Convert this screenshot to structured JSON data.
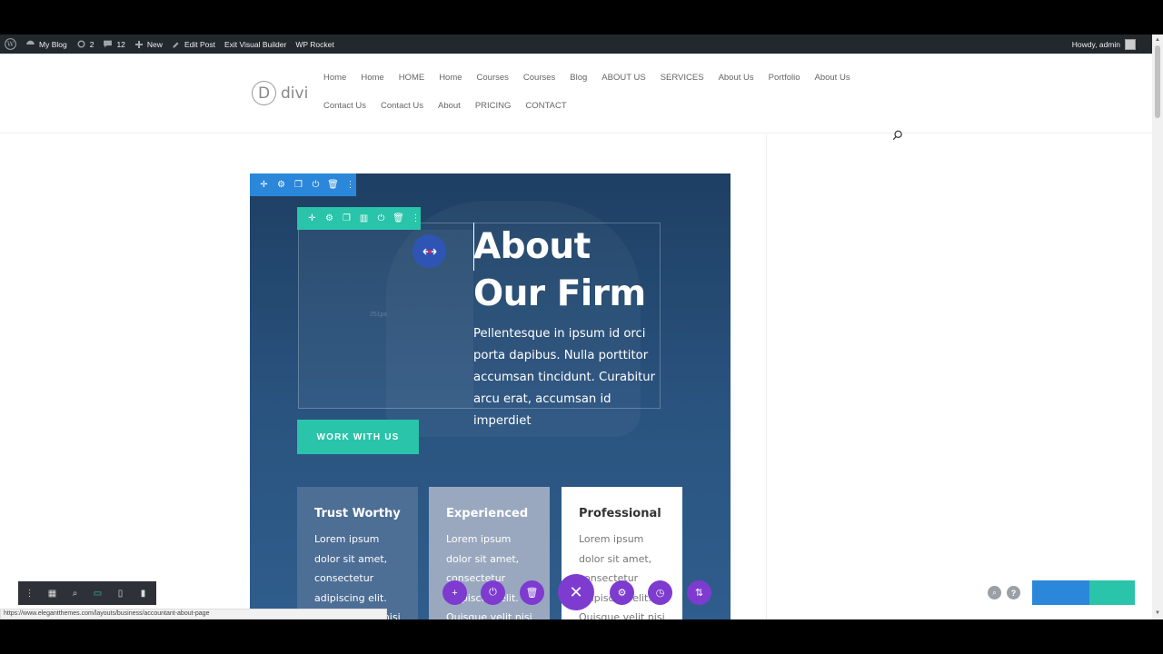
{
  "adminbar": {
    "site": "My Blog",
    "updates": "2",
    "comments": "12",
    "new": "New",
    "edit_post": "Edit Post",
    "exit_vb": "Exit Visual Builder",
    "wp_rocket": "WP Rocket",
    "howdy": "Howdy, admin"
  },
  "header": {
    "logo_letter": "D",
    "logo_text": "divi",
    "nav_row1": [
      "Home",
      "Home",
      "HOME",
      "Home",
      "Courses",
      "Courses",
      "Blog",
      "ABOUT US",
      "SERVICES",
      "About Us",
      "Portfolio",
      "About Us"
    ],
    "nav_row2": [
      "Contact Us",
      "Contact Us",
      "About",
      "PRICING",
      "CONTACT"
    ]
  },
  "hero": {
    "title_line1": "About",
    "title_line2": "Our Firm",
    "paragraph": "Pellentesque in ipsum id orci porta dapibus. Nulla porttitor accumsan tincidunt. Curabitur arcu erat, accumsan id imperdiet",
    "column_dim": "251px",
    "cta": "WORK WITH US"
  },
  "cards": [
    {
      "title": "Trust Worthy",
      "text": "Lorem ipsum dolor sit amet, consectetur adipiscing elit. Quisque velit nisi"
    },
    {
      "title": "Experienced",
      "text": "Lorem ipsum dolor sit amet, consectetur adipiscing elit. Quisque velit nisi"
    },
    {
      "title": "Professional",
      "text": "Lorem ipsum dolor sit amet, consectetur adipiscing elit. Quisque velit nisi"
    }
  ],
  "status_url": "https://www.elegantthemes.com/layouts/business/accountant-about-page",
  "colors": {
    "section_toolbar": "#2b87da",
    "row_toolbar": "#29c4a9",
    "builder_purple": "#7e3bd0",
    "cta": "#29c4a9"
  }
}
